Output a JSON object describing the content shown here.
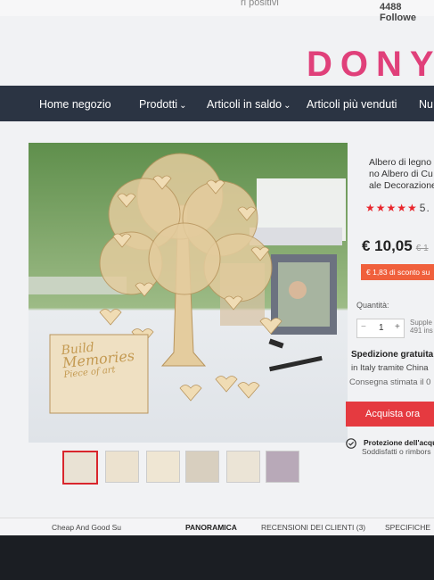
{
  "header": {
    "top_text": "ri positivi",
    "followers": "4488 Followe",
    "brand": "DONY"
  },
  "nav": {
    "items": [
      "Home negozio",
      "Prodotti",
      "Articoli in saldo",
      "Articoli più venduti",
      "Nu"
    ]
  },
  "product": {
    "title_lines": [
      "Albero di legno",
      "no Albero di Cu",
      "ale Decorazione"
    ],
    "stars": "★★★★★",
    "rating": "5.",
    "price": "€ 10,05",
    "old_price": "€ 1",
    "discount": "€ 1,83 di sconto su",
    "quantity_label": "Quantità:",
    "quantity_value": "1",
    "qty_minus": "−",
    "qty_plus": "+",
    "supply_lines": [
      "Supple",
      "491 ins"
    ],
    "shipping_title": "Spedizione gratuita",
    "shipping_sub": "in Italy tramite China",
    "shipping_est": "Consegna stimata il 0",
    "buy_label": "Acquista ora",
    "protection_title": "Protezione dell'acqu",
    "protection_sub": "Soddisfatti o rimbors"
  },
  "image_text": {
    "line1": "Build",
    "line2": "Memories",
    "line3": "Piece of art"
  },
  "bottom_tabs": [
    "Cheap And Good Su",
    "PANORAMICA",
    "RECENSIONI DEI CLIENTI (3)",
    "SPECIFICHE"
  ]
}
